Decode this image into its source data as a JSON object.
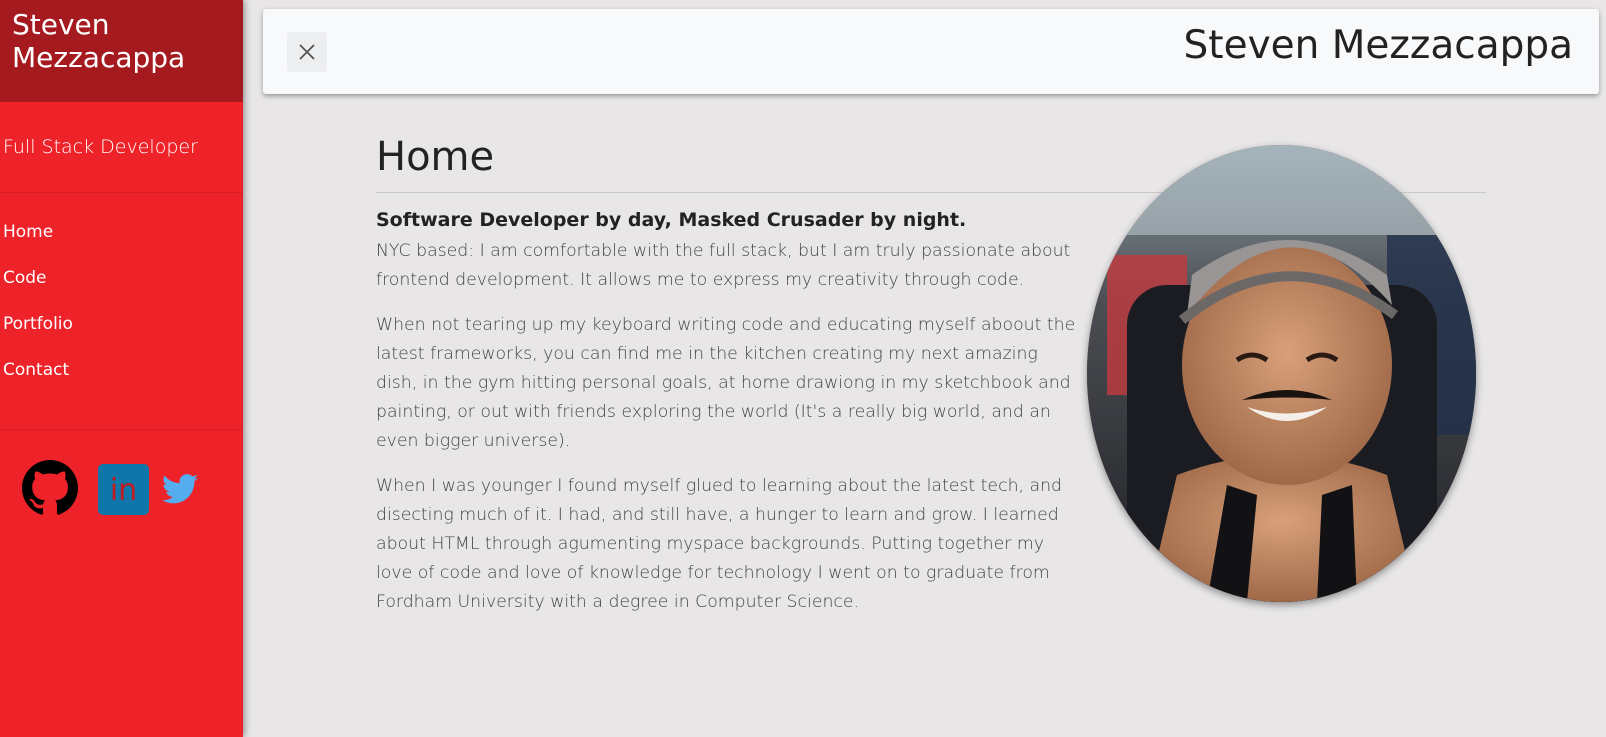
{
  "sidebar": {
    "brand": "Steven Mezzacappa",
    "tagline": "Full Stack Developer",
    "nav": [
      "Home",
      "Code",
      "Portfolio",
      "Contact"
    ],
    "social": [
      {
        "icon": "github-icon",
        "color": "#000000"
      },
      {
        "icon": "linkedin-icon",
        "color": "#0e76a8",
        "text": "in"
      },
      {
        "icon": "twitter-icon",
        "color": "#55acee"
      }
    ],
    "colors": {
      "brand_bg": "#a51a1f",
      "sidebar_bg": "#ee2229"
    }
  },
  "topbar": {
    "title": "Steven Mezzacappa",
    "close_icon": "close-icon"
  },
  "main": {
    "title": "Home",
    "lead": "Software Developer by day, Masked Crusader by night.",
    "paragraphs": [
      "NYC based: I am comfortable with the full stack, but I am truly passionate about frontend development. It allows me to express my creativity through code.",
      "When not tearing up my keyboard writing code and educating myself aboout the latest frameworks, you can find me in the kitchen creating my next amazing dish, in the gym hitting personal goals, at home drawiong in my sketchbook and painting, or out with friends exploring the world (It's a really big world, and an even bigger universe).",
      "When I was younger I found myself glued to learning about the latest tech, and disecting much of it. I had, and still have, a hunger to learn and grow. I learned about HTML through agumenting myspace backgrounds. Putting together my love of code and love of knowledge for technology I went on to graduate from Fordham University with a degree in Computer Science."
    ]
  }
}
